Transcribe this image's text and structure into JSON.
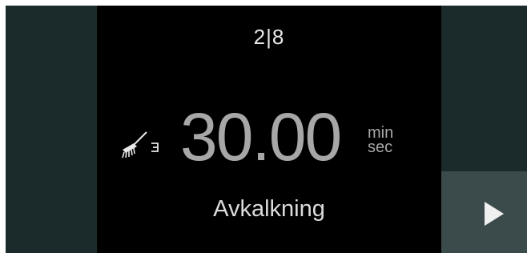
{
  "step": {
    "current": "2",
    "separator": "|",
    "total": "8"
  },
  "timer": {
    "value": "30.00",
    "unit_top": "min",
    "unit_bottom": "sec"
  },
  "program": {
    "name": "Avkalkning",
    "icon": "descaling-brush-icon"
  },
  "navigation": {
    "next_icon": "play-triangle-icon"
  },
  "colors": {
    "side_panel": "#1b2a2b",
    "center_panel": "#000000",
    "next_button": "#3b4a4b",
    "timer_text": "#a7a7a7",
    "label_text": "#dcdcdc"
  }
}
